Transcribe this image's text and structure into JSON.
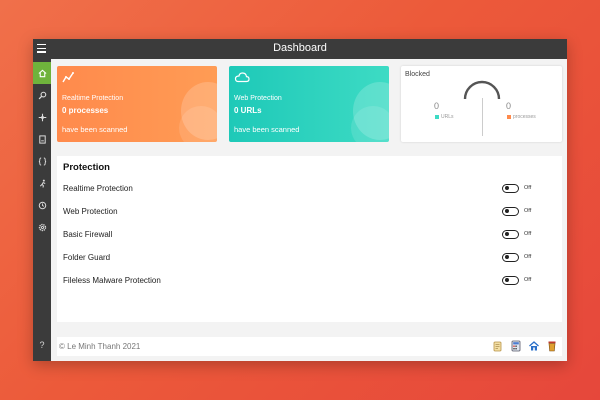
{
  "window": {
    "title": "Dashboard"
  },
  "sidebar": {
    "items": [
      {
        "name": "home",
        "icon": "home-icon"
      },
      {
        "name": "search",
        "icon": "search-icon"
      },
      {
        "name": "network",
        "icon": "move-icon"
      },
      {
        "name": "files",
        "icon": "document-icon"
      },
      {
        "name": "code",
        "icon": "braces-icon"
      },
      {
        "name": "activity",
        "icon": "running-icon"
      },
      {
        "name": "history",
        "icon": "history-icon"
      },
      {
        "name": "settings",
        "icon": "gear-icon"
      },
      {
        "name": "help",
        "icon": "help-icon",
        "label": "?"
      }
    ],
    "accent": "#6fb33c"
  },
  "cards": {
    "realtime": {
      "label": "Realtime Protection",
      "value": "0 processes",
      "sub": "have been scanned",
      "icon": "activity-chart-icon",
      "color": "#ff8a4c"
    },
    "web": {
      "label": "Web Protection",
      "value": "0 URLs",
      "sub": "have been scanned",
      "icon": "cloud-icon",
      "color": "#1ec9b8"
    },
    "blocked": {
      "title": "Blocked",
      "left": {
        "value": "0",
        "label": "URLs",
        "color": "#3ddbc4"
      },
      "right": {
        "value": "0",
        "label": "processes",
        "color": "#ff8a4c"
      }
    }
  },
  "protection": {
    "title": "Protection",
    "items": [
      {
        "label": "Realtime Protection",
        "state": "Off"
      },
      {
        "label": "Web Protection",
        "state": "Off"
      },
      {
        "label": "Basic Firewall",
        "state": "Off"
      },
      {
        "label": "Folder Guard",
        "state": "Off"
      },
      {
        "label": "Fileless Malware Protection",
        "state": "Off"
      }
    ]
  },
  "footer": {
    "copyright": "© Le Minh Thanh 2021",
    "icons": [
      "scroll-icon",
      "calculator-icon",
      "home-network-icon",
      "trash-icon"
    ]
  }
}
